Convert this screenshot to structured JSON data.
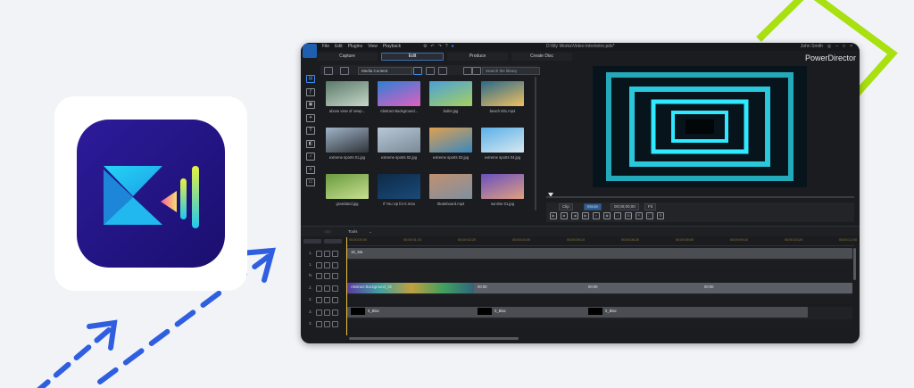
{
  "window": {
    "menu": [
      "File",
      "Edit",
      "Plugins",
      "View",
      "Playback"
    ],
    "title_path": "D:\\My Works\\Video Intro\\intro.pds*",
    "user": "John Smith",
    "brand": "PowerDirector",
    "tabs": [
      {
        "label": "Capture",
        "active": false
      },
      {
        "label": "Edit",
        "active": true
      },
      {
        "label": "Produce",
        "active": false
      },
      {
        "label": "Create Disc",
        "active": false
      }
    ]
  },
  "media": {
    "dropdown": "Media Content",
    "search_placeholder": "Search the library",
    "items": [
      {
        "label": "above view of newp...",
        "colors": [
          "#5a7a6a",
          "#c7d7c8"
        ]
      },
      {
        "label": "Abstract Background...",
        "colors": [
          "#2f7fd6",
          "#e060c0"
        ]
      },
      {
        "label": "bullet.jpg",
        "colors": [
          "#4aa0d8",
          "#a8d060"
        ]
      },
      {
        "label": "beach 001.mp4",
        "colors": [
          "#2a6a8a",
          "#f0c060"
        ]
      },
      {
        "label": "extreme sports 01.jpg",
        "colors": [
          "#a0b4c8",
          "#30343a"
        ]
      },
      {
        "label": "extreme sports 02.jpg",
        "colors": [
          "#b8c8d8",
          "#7a8a96"
        ]
      },
      {
        "label": "extreme sports 03.jpg",
        "colors": [
          "#e0a050",
          "#3a88c0"
        ]
      },
      {
        "label": "extreme sports 04.jpg",
        "colors": [
          "#5ab0e8",
          "#d8e8f0"
        ]
      },
      {
        "label": "grassland.jpg",
        "colors": [
          "#6a9a40",
          "#c8e090"
        ]
      },
      {
        "label": "If You Up for It.m4a",
        "colors": [
          "#0e2a48",
          "#1a4a78"
        ]
      },
      {
        "label": "Skateboard.mp4",
        "colors": [
          "#c09070",
          "#8090a0"
        ]
      },
      {
        "label": "sunrise 01.jpg",
        "colors": [
          "#6a50c0",
          "#e0a080"
        ]
      }
    ]
  },
  "preview": {
    "clip_label": "Clip",
    "movie_label": "Movie",
    "timecode": "00;00;00;00",
    "fit": "Fit"
  },
  "timeline": {
    "tools_label": "Tools",
    "ruler_ticks": [
      "00;00;00;00",
      "00;00;01;10",
      "00;00;02;20",
      "00;00;04;00",
      "00;00;05;10",
      "00;00;06;20",
      "00;00;08;00",
      "00;00;09;10",
      "00;00;10;20",
      "00;00;12;00"
    ],
    "tracks": [
      {
        "num": "1."
      },
      {
        "num": "1."
      },
      {
        "num": "fx"
      },
      {
        "num": "2."
      },
      {
        "num": "2."
      },
      {
        "num": "3."
      },
      {
        "num": "3."
      }
    ],
    "clip_labels": {
      "track1": "1E_Ma",
      "fx_main": "Abstract Background_02",
      "clip_a": "00:00",
      "clip_b": "00:00",
      "clip_c": "00:00",
      "black_1": "0_Blac",
      "black_2": "0_Blac",
      "black_3": "0_Blac"
    }
  },
  "colors": {
    "accent_green": "#a8e010",
    "arrow_blue": "#2f5fe0",
    "icon_purple": "#3a1fa8",
    "icon_cyan": "#20c8f0"
  }
}
